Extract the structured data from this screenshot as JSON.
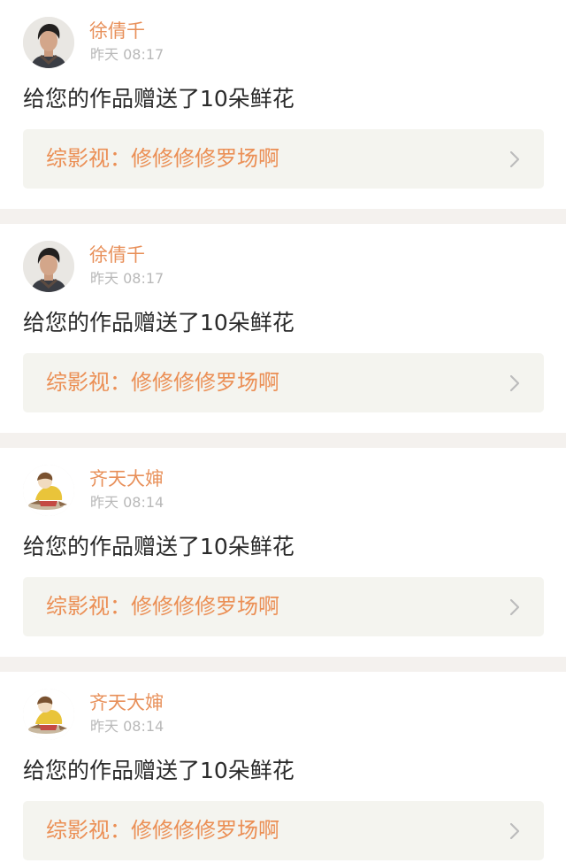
{
  "colors": {
    "accent": "#e8905a",
    "link_background": "#f4f4ef",
    "separator": "#f4f1ee",
    "time_text": "#b9b9b9",
    "message_text": "#2a2a2a"
  },
  "notifications": [
    {
      "user_name": "徐倩千",
      "time": "昨天 08:17",
      "message": "给您的作品赠送了10朵鲜花",
      "work_title": "综影视：修修修修罗场啊",
      "avatar_icon": "young-man-avatar",
      "link_icon": "chevron-right-icon"
    },
    {
      "user_name": "徐倩千",
      "time": "昨天 08:17",
      "message": "给您的作品赠送了10朵鲜花",
      "work_title": "综影视：修修修修罗场啊",
      "avatar_icon": "young-man-avatar",
      "link_icon": "chevron-right-icon"
    },
    {
      "user_name": "齐天大婶",
      "time": "昨天 08:14",
      "message": "给您的作品赠送了10朵鲜花",
      "work_title": "综影视：修修修修罗场啊",
      "avatar_icon": "cartoon-figure-avatar",
      "link_icon": "chevron-right-icon"
    },
    {
      "user_name": "齐天大婶",
      "time": "昨天 08:14",
      "message": "给您的作品赠送了10朵鲜花",
      "work_title": "综影视：修修修修罗场啊",
      "avatar_icon": "cartoon-figure-avatar",
      "link_icon": "chevron-right-icon"
    }
  ]
}
